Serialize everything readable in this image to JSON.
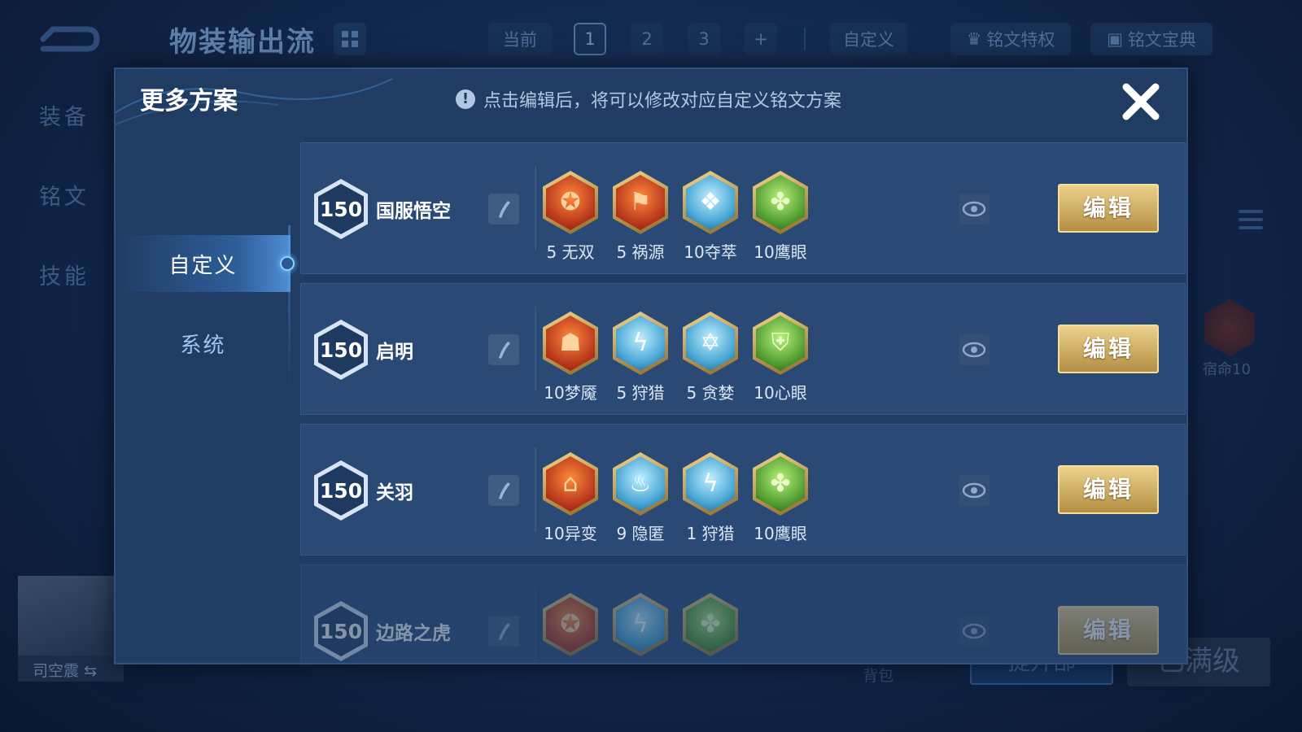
{
  "background": {
    "plan_title": "物装输出流",
    "tabs": [
      "当前",
      "1",
      "2",
      "3",
      "+"
    ],
    "custom_tab": "自定义",
    "privilege_btn": "铭文特权",
    "manual_btn": "铭文宝典",
    "left_nav": [
      "装备",
      "铭文",
      "技能"
    ],
    "rune_label": "宿命10",
    "hero_name": "司空震",
    "bag_label": "背包",
    "upgrade_btn": "提升部",
    "max_btn": "已满级"
  },
  "modal": {
    "title": "更多方案",
    "hint": "点击编辑后，将可以修改对应自定义铭文方案",
    "hint_icon": "!",
    "close_icon": "close-icon",
    "side_tabs": [
      "自定义",
      "系统"
    ],
    "edit_label": "编辑",
    "plans": [
      {
        "level": "150",
        "name": "国服悟空",
        "runes": [
          {
            "label": "5 无双",
            "color": "red",
            "icon": "rune-crest-icon"
          },
          {
            "label": "5 祸源",
            "color": "red",
            "icon": "rune-banner-icon"
          },
          {
            "label": "10夺萃",
            "color": "blue",
            "icon": "rune-knot-icon"
          },
          {
            "label": "10鹰眼",
            "color": "green",
            "icon": "rune-clover-icon"
          }
        ]
      },
      {
        "level": "150",
        "name": "启明",
        "runes": [
          {
            "label": "10梦魇",
            "color": "red",
            "icon": "rune-mask-icon"
          },
          {
            "label": "5 狩猎",
            "color": "blue",
            "icon": "rune-lightning-icon"
          },
          {
            "label": "5 贪婪",
            "color": "blue",
            "icon": "rune-star-icon"
          },
          {
            "label": "10心眼",
            "color": "green",
            "icon": "rune-shield-icon"
          }
        ]
      },
      {
        "level": "150",
        "name": "关羽",
        "runes": [
          {
            "label": "10异变",
            "color": "red",
            "icon": "rune-arch-icon"
          },
          {
            "label": "9 隐匿",
            "color": "blue",
            "icon": "rune-flame-icon"
          },
          {
            "label": "1 狩猎",
            "color": "blue",
            "icon": "rune-lightning-icon"
          },
          {
            "label": "10鹰眼",
            "color": "green",
            "icon": "rune-clover-icon"
          }
        ]
      },
      {
        "level": "150",
        "name": "边路之虎",
        "runes": [
          {
            "label": "",
            "color": "red",
            "icon": "rune-crest-icon"
          },
          {
            "label": "",
            "color": "blue",
            "icon": "rune-lightning-icon"
          },
          {
            "label": "",
            "color": "green",
            "icon": "rune-clover-icon"
          }
        ]
      }
    ]
  }
}
